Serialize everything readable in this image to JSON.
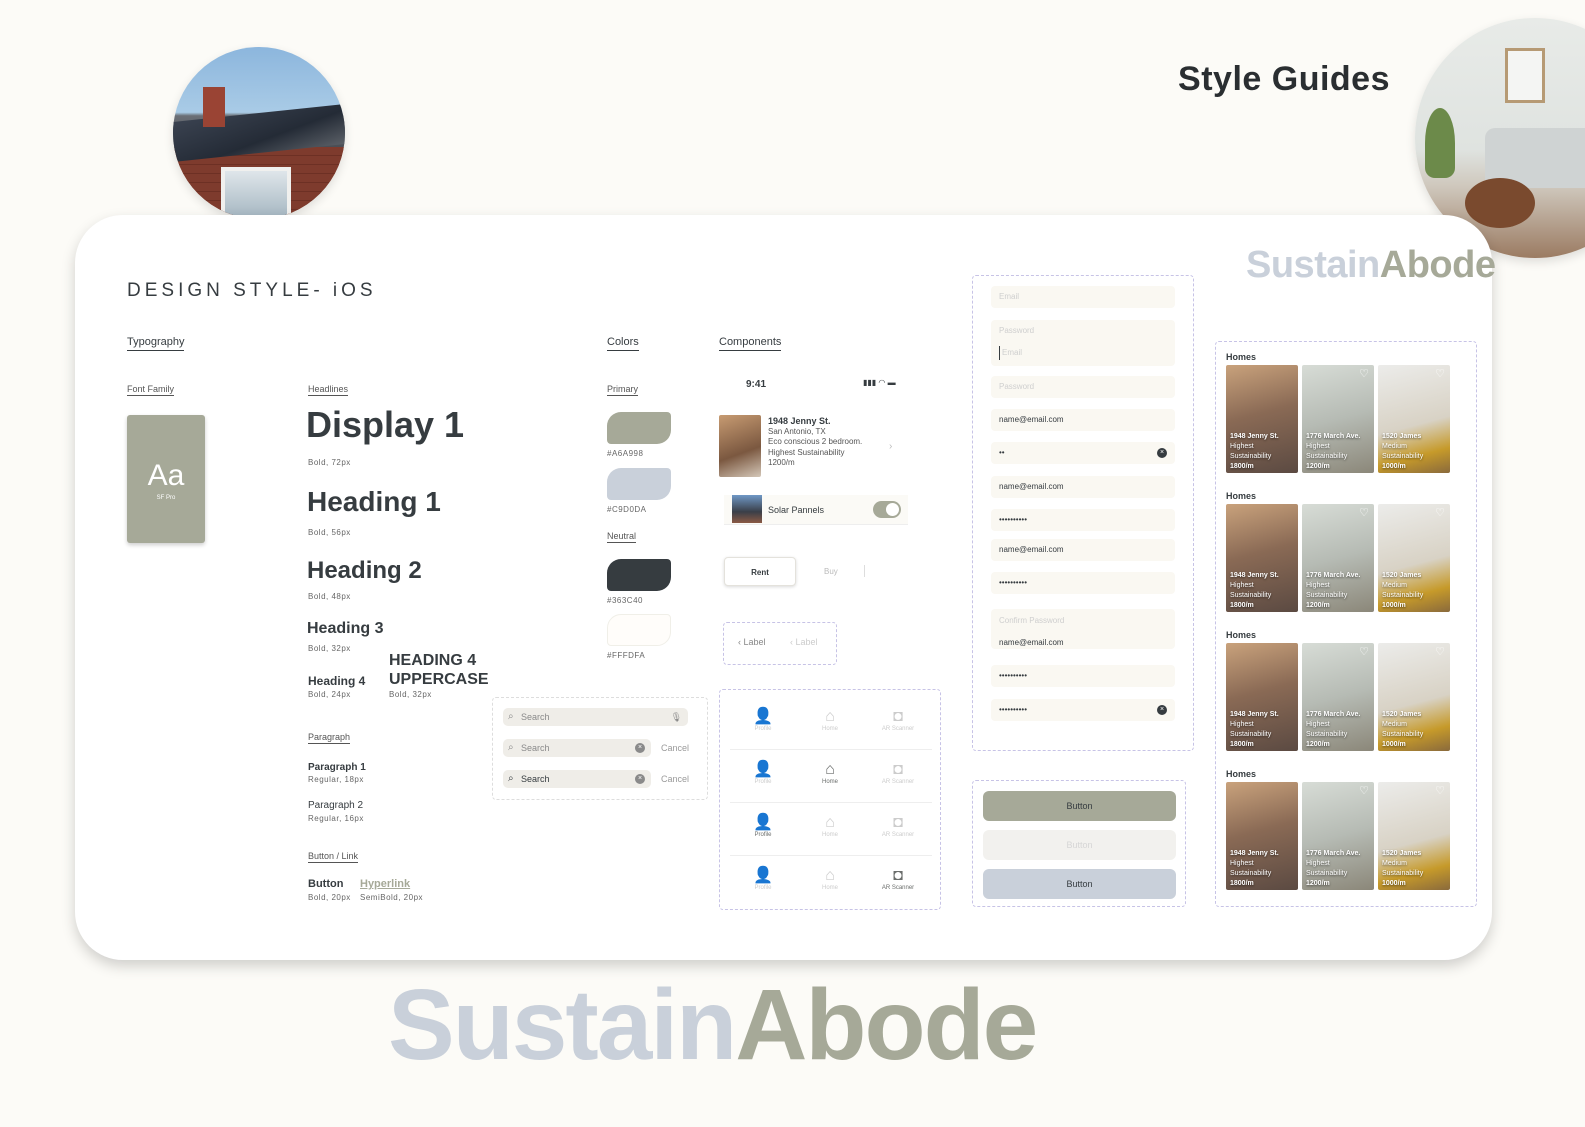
{
  "header": {
    "title": "Style Guides"
  },
  "brand": {
    "part1": "Sustain",
    "part2": "Abode"
  },
  "design": {
    "title": "DESIGN STYLE- iOS"
  },
  "typography": {
    "section": "Typography",
    "font_family_label": "Font Family",
    "font_sample": "Aa",
    "font_name": "SF Pro",
    "headlines_label": "Headlines",
    "display1": {
      "label": "Display 1",
      "meta": "Bold, 72px"
    },
    "heading1": {
      "label": "Heading 1",
      "meta": "Bold, 56px"
    },
    "heading2": {
      "label": "Heading 2",
      "meta": "Bold, 48px"
    },
    "heading3": {
      "label": "Heading 3",
      "meta": "Bold, 32px"
    },
    "heading4": {
      "label": "Heading 4",
      "meta": "Bold, 24px"
    },
    "heading4u": {
      "label1": "HEADING 4",
      "label2": "UPPERCASE",
      "meta": "Bold, 32px"
    },
    "paragraph_label": "Paragraph",
    "paragraph1": {
      "label": "Paragraph 1",
      "meta": "Regular, 18px"
    },
    "paragraph2": {
      "label": "Paragraph 2",
      "meta": "Regular, 16px"
    },
    "button_link_label": "Button / Link",
    "button": {
      "label": "Button",
      "meta": "Bold, 20px"
    },
    "hyperlink": {
      "label": "Hyperlink",
      "meta": "SemiBold, 20px"
    }
  },
  "colors": {
    "section": "Colors",
    "primary_label": "Primary",
    "neutral_label": "Neutral",
    "primary": [
      {
        "hex": "#A6A998"
      },
      {
        "hex": "#C9D0DA"
      }
    ],
    "neutral": [
      {
        "hex": "#363C40"
      },
      {
        "hex": "#FFFDFA"
      }
    ]
  },
  "components": {
    "section": "Components",
    "status_time": "9:41",
    "listing": {
      "title": "1948 Jenny St.",
      "city": "San Antonio, TX",
      "desc": "Eco conscious 2 bedroom.",
      "sustainability": "Highest Sustainability",
      "price": "1200/m"
    },
    "toggle_label": "Solar Pannels",
    "segment": {
      "active": "Rent",
      "inactive": "Buy"
    },
    "back": {
      "label1": "Label",
      "label2": "Label"
    },
    "tabs": {
      "profile": "Profile",
      "home": "Home",
      "scanner": "AR Scanner"
    }
  },
  "search": {
    "placeholder": "Search",
    "cancel": "Cancel"
  },
  "forms": {
    "email_placeholder": "Email",
    "password_placeholder": "Password",
    "email_value": "name@email.com",
    "password_partial": "••",
    "password_value": "••••••••••",
    "confirm_placeholder": "Confirm Password"
  },
  "buttons": {
    "label": "Button",
    "colors": {
      "primary": "#A6A998",
      "disabled": "#F2F1EE",
      "secondary": "#C9D0DA"
    }
  },
  "homes": {
    "title": "Homes",
    "cards": [
      {
        "name": "1948 Jenny St.",
        "level": "Highest",
        "metric": "Sustainability",
        "price": "1800/m"
      },
      {
        "name": "1776 March Ave.",
        "level": "Highest",
        "metric": "Sustainability",
        "price": "1200/m"
      },
      {
        "name": "1520 James",
        "level": "Medium",
        "metric": "Sustainability",
        "price": "1000/m"
      }
    ]
  }
}
